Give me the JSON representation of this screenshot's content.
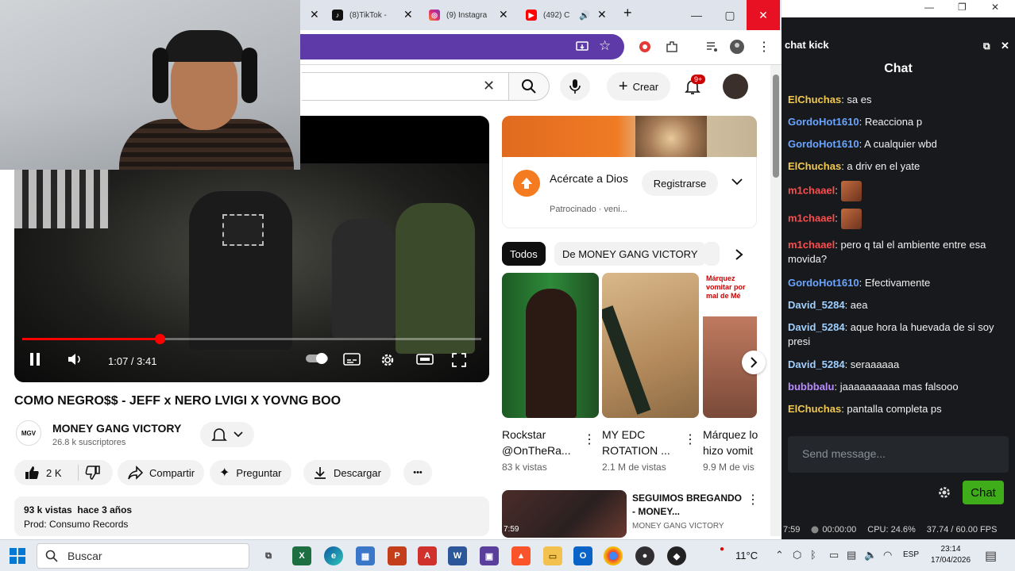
{
  "browser": {
    "tabs": [
      {
        "label": "(8)TikTok -",
        "icon": "tiktok-icon"
      },
      {
        "label": "(9) Instagra",
        "icon": "instagram-icon"
      },
      {
        "label": "(492) C",
        "icon": "youtube-icon"
      }
    ],
    "new_tab": "+",
    "window_controls": {
      "minimize": "—",
      "maximize": "▢",
      "close": "✕"
    }
  },
  "youtube": {
    "header": {
      "crear_label": "Crear",
      "notif_badge": "9+"
    },
    "player": {
      "time": "1:07 / 3:41",
      "progress": 0.3
    },
    "video": {
      "title": "COMO NEGRO$$ - JEFF x NERO LVIGI X YOVNG BOO",
      "channel": "MONEY GANG VICTORY",
      "subscribers": "26.8 k suscriptores",
      "channel_avatar_text": "MGV",
      "likes": "2 K",
      "share_label": "Compartir",
      "ask_label": "Preguntar",
      "download_label": "Descargar",
      "more_label": "•••",
      "desc_line1": "93 k vistas  hace 3 años",
      "desc_line2": "Prod: Consumo Records"
    },
    "ad": {
      "title": "Acércate a Dios",
      "sponsor": "Patrocinado · veni...",
      "register_label": "Registrarse"
    },
    "chips": [
      "Todos",
      "De MONEY GANG VICTORY"
    ],
    "shorts": [
      {
        "title": "Rockstar @OnTheRa...",
        "views": "83 k vistas"
      },
      {
        "title": "MY EDC ROTATION ...",
        "views": "2.1 M de vistas"
      },
      {
        "title": "Márquez lo hizo vomit",
        "views": "9.9 M de vis",
        "thumb_text": "Márquez vomitar por mal de Mé"
      }
    ],
    "related": {
      "title": "SEGUIMOS BREGANDO - MONEY...",
      "channel": "MONEY GANG VICTORY",
      "thumb_text": "7:59"
    }
  },
  "kick": {
    "window_title": "chat kick",
    "header": "Chat",
    "messages": [
      {
        "user": "ElChuchas",
        "color": "#f2c94c",
        "text": "sa es"
      },
      {
        "user": "GordoHot1610",
        "color": "#6aa5ff",
        "text": "Reacciona p"
      },
      {
        "user": "GordoHot1610",
        "color": "#6aa5ff",
        "text": "A cualquier wbd"
      },
      {
        "user": "ElChuchas",
        "color": "#f2c94c",
        "text": "a driv en el yate"
      },
      {
        "user": "m1chaael",
        "color": "#ff4d4d",
        "text": ""
      },
      {
        "user": "m1chaael",
        "color": "#ff4d4d",
        "text": ""
      },
      {
        "user": "m1chaael",
        "color": "#ff4d4d",
        "text": "pero q tal el ambiente entre esa movida?"
      },
      {
        "user": "GordoHot1610",
        "color": "#6aa5ff",
        "text": "Efectivamente"
      },
      {
        "user": "David_5284",
        "color": "#9fd0ff",
        "text": "aea"
      },
      {
        "user": "David_5284",
        "color": "#9fd0ff",
        "text": "aque hora la huevada de si soy presi"
      },
      {
        "user": "David_5284",
        "color": "#9fd0ff",
        "text": "seraaaaaa"
      },
      {
        "user": "bubbbalu",
        "color": "#b98cff",
        "text": "jaaaaaaaaaa mas falsooo"
      },
      {
        "user": "ElChuchas",
        "color": "#f2c94c",
        "text": "pantalla completa ps"
      }
    ],
    "input_placeholder": "Send message...",
    "chat_button": "Chat",
    "stats": {
      "time": "7:59",
      "rec": "00:00:00",
      "cpu": "CPU: 24.6%",
      "fps": "37.74 / 60.00 FPS"
    }
  },
  "taskbar": {
    "search_placeholder": "Buscar",
    "weather": "11°C",
    "lang": "ESP",
    "time": "23:14",
    "date": "17/04/2026",
    "apps": [
      "task-view",
      "excel",
      "edge",
      "store",
      "powerpoint",
      "acrobat",
      "word",
      "photos",
      "brave",
      "explorer",
      "outlook",
      "chrome",
      "obs",
      "kick"
    ]
  },
  "colors": {
    "yt_red": "#ff0000",
    "kick_green": "#53fc18",
    "addr_purple": "#5e3aa8"
  }
}
